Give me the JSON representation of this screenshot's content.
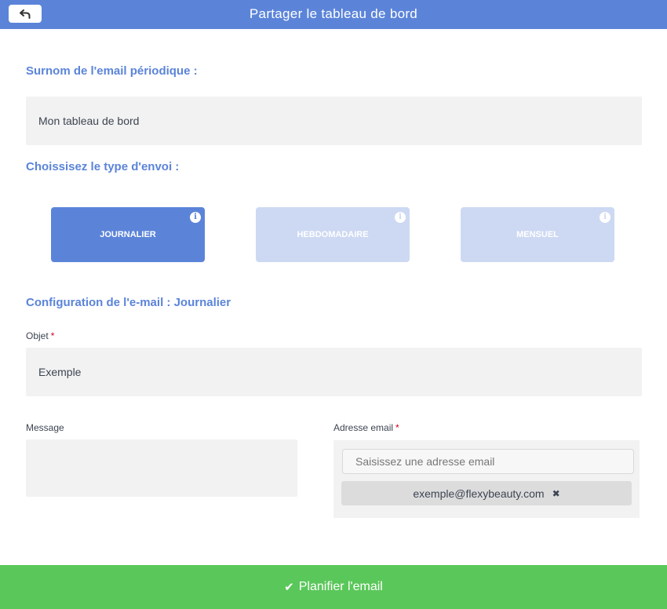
{
  "header": {
    "title": "Partager le tableau de bord",
    "back_icon": "back-arrow-icon"
  },
  "nickname": {
    "label": "Surnom de l'email périodique :",
    "value": "Mon tableau de bord"
  },
  "send_type": {
    "label": "Choissisez le type d'envoi :",
    "options": [
      {
        "label": "JOURNALIER",
        "selected": true
      },
      {
        "label": "HEBDOMADAIRE",
        "selected": false
      },
      {
        "label": "MENSUEL",
        "selected": false
      }
    ],
    "info_glyph": "i"
  },
  "config": {
    "title": "Configuration de l'e-mail : Journalier",
    "subject_label": "Objet",
    "subject_value": "Exemple",
    "required_mark": "*",
    "message_label": "Message",
    "message_value": "",
    "email_label": "Adresse email",
    "email_placeholder": "Saisissez une adresse email",
    "email_tags": [
      "exemple@flexybeauty.com"
    ],
    "tag_remove_glyph": "✖"
  },
  "submit": {
    "label": "Planifier l'email",
    "check_glyph": "✔"
  },
  "colors": {
    "primary": "#5b84d9",
    "primary_light": "#cdd9f3",
    "success": "#5ac75a",
    "field_bg": "#f2f2f2",
    "required": "#d0021b"
  }
}
